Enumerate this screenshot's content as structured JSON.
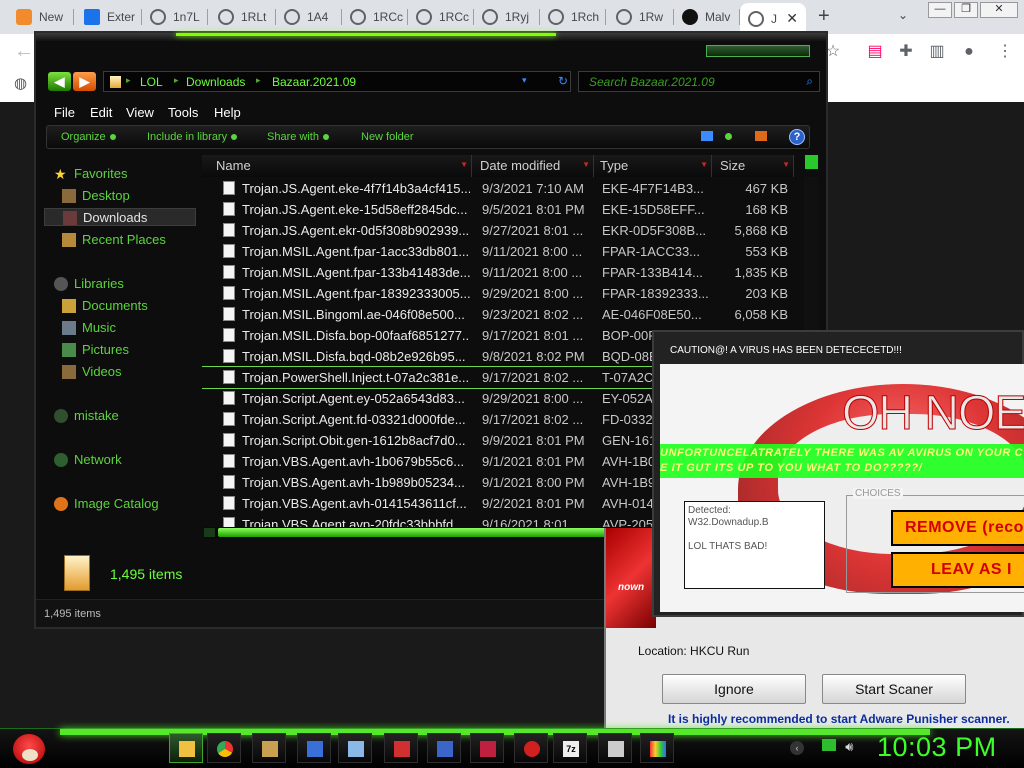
{
  "browser": {
    "tabs": [
      {
        "label": "New",
        "icon": "new-tab-icon",
        "color": "#f28b2d"
      },
      {
        "label": "Exter",
        "icon": "extension-icon",
        "color": "#1a73e8"
      },
      {
        "label": "1n7L",
        "icon": "globe-icon",
        "color": "#5f6368"
      },
      {
        "label": "1RLt",
        "icon": "globe-icon",
        "color": "#5f6368"
      },
      {
        "label": "1A4",
        "icon": "globe-icon",
        "color": "#5f6368"
      },
      {
        "label": "1RCc",
        "icon": "globe-icon",
        "color": "#5f6368"
      },
      {
        "label": "1RCc",
        "icon": "globe-icon",
        "color": "#5f6368"
      },
      {
        "label": "1Ryj",
        "icon": "globe-icon",
        "color": "#5f6368"
      },
      {
        "label": "1Rch",
        "icon": "globe-icon",
        "color": "#5f6368"
      },
      {
        "label": "1Rw",
        "icon": "globe-icon",
        "color": "#5f6368"
      },
      {
        "label": "Malv",
        "icon": "github-icon",
        "color": "#111111"
      },
      {
        "label": "J",
        "icon": "globe-icon",
        "color": "#5f6368"
      }
    ],
    "new_tab": "+",
    "tab_menu": "⌄"
  },
  "explorer": {
    "path": [
      "LOL",
      "Downloads",
      "Bazaar.2021.09"
    ],
    "search_placeholder": "Search Bazaar.2021.09",
    "menu": [
      "File",
      "Edit",
      "View",
      "Tools",
      "Help"
    ],
    "toolbar": [
      "Organize",
      "Include in library",
      "Share with",
      "New folder"
    ],
    "nav": {
      "favorites": "Favorites",
      "desktop": "Desktop",
      "downloads": "Downloads",
      "recent": "Recent Places",
      "libraries": "Libraries",
      "documents": "Documents",
      "music": "Music",
      "pictures": "Pictures",
      "videos": "Videos",
      "mistake": "mistake",
      "network": "Network",
      "image_catalog": "Image Catalog"
    },
    "columns": {
      "name": "Name",
      "date": "Date modified",
      "type": "Type",
      "size": "Size"
    },
    "files": [
      {
        "name": "Trojan.JS.Agent.eke-4f7f14b3a4cf415...",
        "date": "9/3/2021 7:10 AM",
        "type": "EKE-4F7F14B3...",
        "size": "467 KB"
      },
      {
        "name": "Trojan.JS.Agent.eke-15d58eff2845dc...",
        "date": "9/5/2021 8:01 PM",
        "type": "EKE-15D58EFF...",
        "size": "168 KB"
      },
      {
        "name": "Trojan.JS.Agent.ekr-0d5f308b902939...",
        "date": "9/27/2021 8:01 ...",
        "type": "EKR-0D5F308B...",
        "size": "5,868 KB"
      },
      {
        "name": "Trojan.MSIL.Agent.fpar-1acc33db801...",
        "date": "9/11/2021 8:00 ...",
        "type": "FPAR-1ACC33...",
        "size": "553 KB"
      },
      {
        "name": "Trojan.MSIL.Agent.fpar-133b41483de...",
        "date": "9/11/2021 8:00 ...",
        "type": "FPAR-133B414...",
        "size": "1,835 KB"
      },
      {
        "name": "Trojan.MSIL.Agent.fpar-18392333005...",
        "date": "9/29/2021 8:00 ...",
        "type": "FPAR-18392333...",
        "size": "203 KB"
      },
      {
        "name": "Trojan.MSIL.Bingoml.ae-046f08e500...",
        "date": "9/23/2021 8:02 ...",
        "type": "AE-046F08E50...",
        "size": "6,058 KB"
      },
      {
        "name": "Trojan.MSIL.Disfa.bop-00faaf6851277...",
        "date": "9/17/2021 8:01 ...",
        "type": "BOP-00F",
        "size": ""
      },
      {
        "name": "Trojan.MSIL.Disfa.bqd-08b2e926b95...",
        "date": "9/8/2021 8:02 PM",
        "type": "BQD-08E",
        "size": ""
      },
      {
        "name": "Trojan.PowerShell.Inject.t-07a2c381e...",
        "date": "9/17/2021 8:02 ...",
        "type": "T-07A2C",
        "size": ""
      },
      {
        "name": "Trojan.Script.Agent.ey-052a6543d83...",
        "date": "9/29/2021 8:00 ...",
        "type": "EY-052A",
        "size": ""
      },
      {
        "name": "Trojan.Script.Agent.fd-03321d000fde...",
        "date": "9/17/2021 8:02 ...",
        "type": "FD-0332",
        "size": ""
      },
      {
        "name": "Trojan.Script.Obit.gen-1612b8acf7d0...",
        "date": "9/9/2021 8:01 PM",
        "type": "GEN-161",
        "size": ""
      },
      {
        "name": "Trojan.VBS.Agent.avh-1b0679b55c6...",
        "date": "9/1/2021 8:01 PM",
        "type": "AVH-1B0",
        "size": ""
      },
      {
        "name": "Trojan.VBS.Agent.avh-1b989b05234...",
        "date": "9/1/2021 8:00 PM",
        "type": "AVH-1B9",
        "size": ""
      },
      {
        "name": "Trojan.VBS.Agent.avh-0141543611cf...",
        "date": "9/2/2021 8:01 PM",
        "type": "AVH-014",
        "size": ""
      },
      {
        "name": "Trojan.VBS.Agent.avp-20fdc33bbbfd...",
        "date": "9/16/2021 8:01 ...",
        "type": "AVP-205",
        "size": ""
      }
    ],
    "item_count": "1,495 items",
    "status": "1,495 items"
  },
  "popup": {
    "title": "CAUTION@! A VIRUS HAS BEEN DETECECETD!!!",
    "big_text": "OH NOE",
    "banner_line1": "UNFORTUNCELATRATELY THERE WAS AV AVIRUS ON YOUR C",
    "banner_line2": "E IT GUT ITS UP TO YOU WHAT TO DO?????/",
    "detected_label": "Detected:",
    "detected_value": "W32.Downadup.B",
    "detected_note": "LOL THATS BAD!",
    "choices_label": "CHOICES",
    "remove_label": "REMOVE (reco",
    "leave_label": "LEAV AS I"
  },
  "adware": {
    "logo_text": "nown",
    "location": "Location: HKCU Run",
    "ignore": "Ignore",
    "start": "Start Scaner",
    "recommend": "It is highly recommended to start Adware Punisher scanner."
  },
  "taskbar": {
    "clock": "10:03 PM"
  },
  "colors": {
    "accent_green": "#5bd43d",
    "neon_green": "#3cff2a",
    "warning_orange": "#ffb000",
    "warning_red": "#d40000"
  }
}
